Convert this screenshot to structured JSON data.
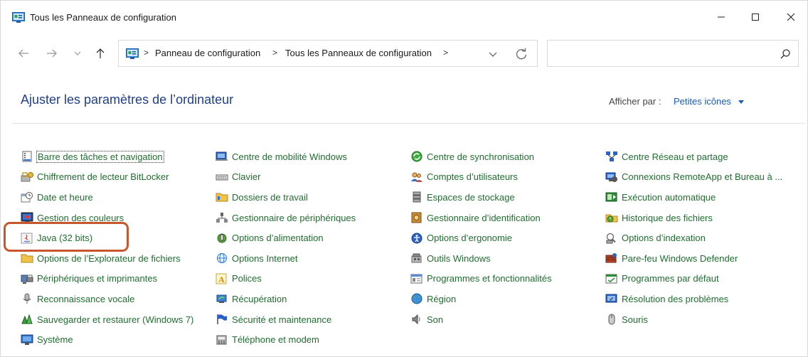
{
  "window": {
    "title": "Tous les Panneaux de configuration",
    "controls": {
      "minimize": "minimize-icon",
      "maximize": "maximize-icon",
      "close": "close-icon"
    }
  },
  "nav": {
    "back_icon": "arrow-left-icon",
    "forward_icon": "arrow-right-icon",
    "recent_icon": "chevron-down-icon",
    "up_icon": "arrow-up-icon"
  },
  "address": {
    "breadcrumbs": [
      "Panneau de configuration",
      "Tous les Panneaux de configuration"
    ],
    "separator": ">"
  },
  "search": {
    "placeholder": ""
  },
  "header": {
    "title": "Ajuster les paramètres de l’ordinateur",
    "viewby_label": "Afficher par :",
    "viewby_value": "Petites icônes"
  },
  "colors": {
    "title": "#1e3f8b",
    "link": "#1f6e2f",
    "accent": "#1a5bb5",
    "highlight": "#c8572d"
  },
  "items": [
    {
      "label": "Barre des tâches et navigation",
      "icon": "taskbar-icon"
    },
    {
      "label": "Chiffrement de lecteur BitLocker",
      "icon": "bitlocker-icon"
    },
    {
      "label": "Date et heure",
      "icon": "clock-icon"
    },
    {
      "label": "Gestion des couleurs",
      "icon": "color-management-icon"
    },
    {
      "label": "Java (32 bits)",
      "icon": "java-icon"
    },
    {
      "label": "Options de l’Explorateur de fichiers",
      "icon": "folder-options-icon"
    },
    {
      "label": "Périphériques et imprimantes",
      "icon": "printer-icon"
    },
    {
      "label": "Reconnaissance vocale",
      "icon": "microphone-icon"
    },
    {
      "label": "Sauvegarder et restaurer (Windows 7)",
      "icon": "backup-icon"
    },
    {
      "label": "Système",
      "icon": "system-icon"
    },
    {
      "label": "Centre de mobilité Windows",
      "icon": "mobility-icon"
    },
    {
      "label": "Clavier",
      "icon": "keyboard-icon"
    },
    {
      "label": "Dossiers de travail",
      "icon": "work-folders-icon"
    },
    {
      "label": "Gestionnaire de périphériques",
      "icon": "device-manager-icon"
    },
    {
      "label": "Options d’alimentation",
      "icon": "power-icon"
    },
    {
      "label": "Options Internet",
      "icon": "internet-icon"
    },
    {
      "label": "Polices",
      "icon": "fonts-icon"
    },
    {
      "label": "Récupération",
      "icon": "recovery-icon"
    },
    {
      "label": "Sécurité et maintenance",
      "icon": "flag-icon"
    },
    {
      "label": "Téléphone et modem",
      "icon": "phone-icon"
    },
    {
      "label": "Centre de synchronisation",
      "icon": "sync-icon"
    },
    {
      "label": "Comptes d’utilisateurs",
      "icon": "users-icon"
    },
    {
      "label": "Espaces de stockage",
      "icon": "storage-icon"
    },
    {
      "label": "Gestionnaire d’identification",
      "icon": "credential-icon"
    },
    {
      "label": "Options d’ergonomie",
      "icon": "accessibility-icon"
    },
    {
      "label": "Outils Windows",
      "icon": "tools-icon"
    },
    {
      "label": "Programmes et fonctionnalités",
      "icon": "programs-icon"
    },
    {
      "label": "Région",
      "icon": "globe-icon"
    },
    {
      "label": "Son",
      "icon": "speaker-icon"
    },
    {
      "label": "Centre Réseau et partage",
      "icon": "network-icon"
    },
    {
      "label": "Connexions RemoteApp et Bureau à ...",
      "icon": "remoteapp-icon"
    },
    {
      "label": "Exécution automatique",
      "icon": "autoplay-icon"
    },
    {
      "label": "Historique des fichiers",
      "icon": "file-history-icon"
    },
    {
      "label": "Options d’indexation",
      "icon": "indexing-icon"
    },
    {
      "label": "Pare-feu Windows Defender",
      "icon": "firewall-icon"
    },
    {
      "label": "Programmes par défaut",
      "icon": "default-programs-icon"
    },
    {
      "label": "Résolution des problèmes",
      "icon": "troubleshoot-icon"
    },
    {
      "label": "Souris",
      "icon": "mouse-icon"
    }
  ]
}
